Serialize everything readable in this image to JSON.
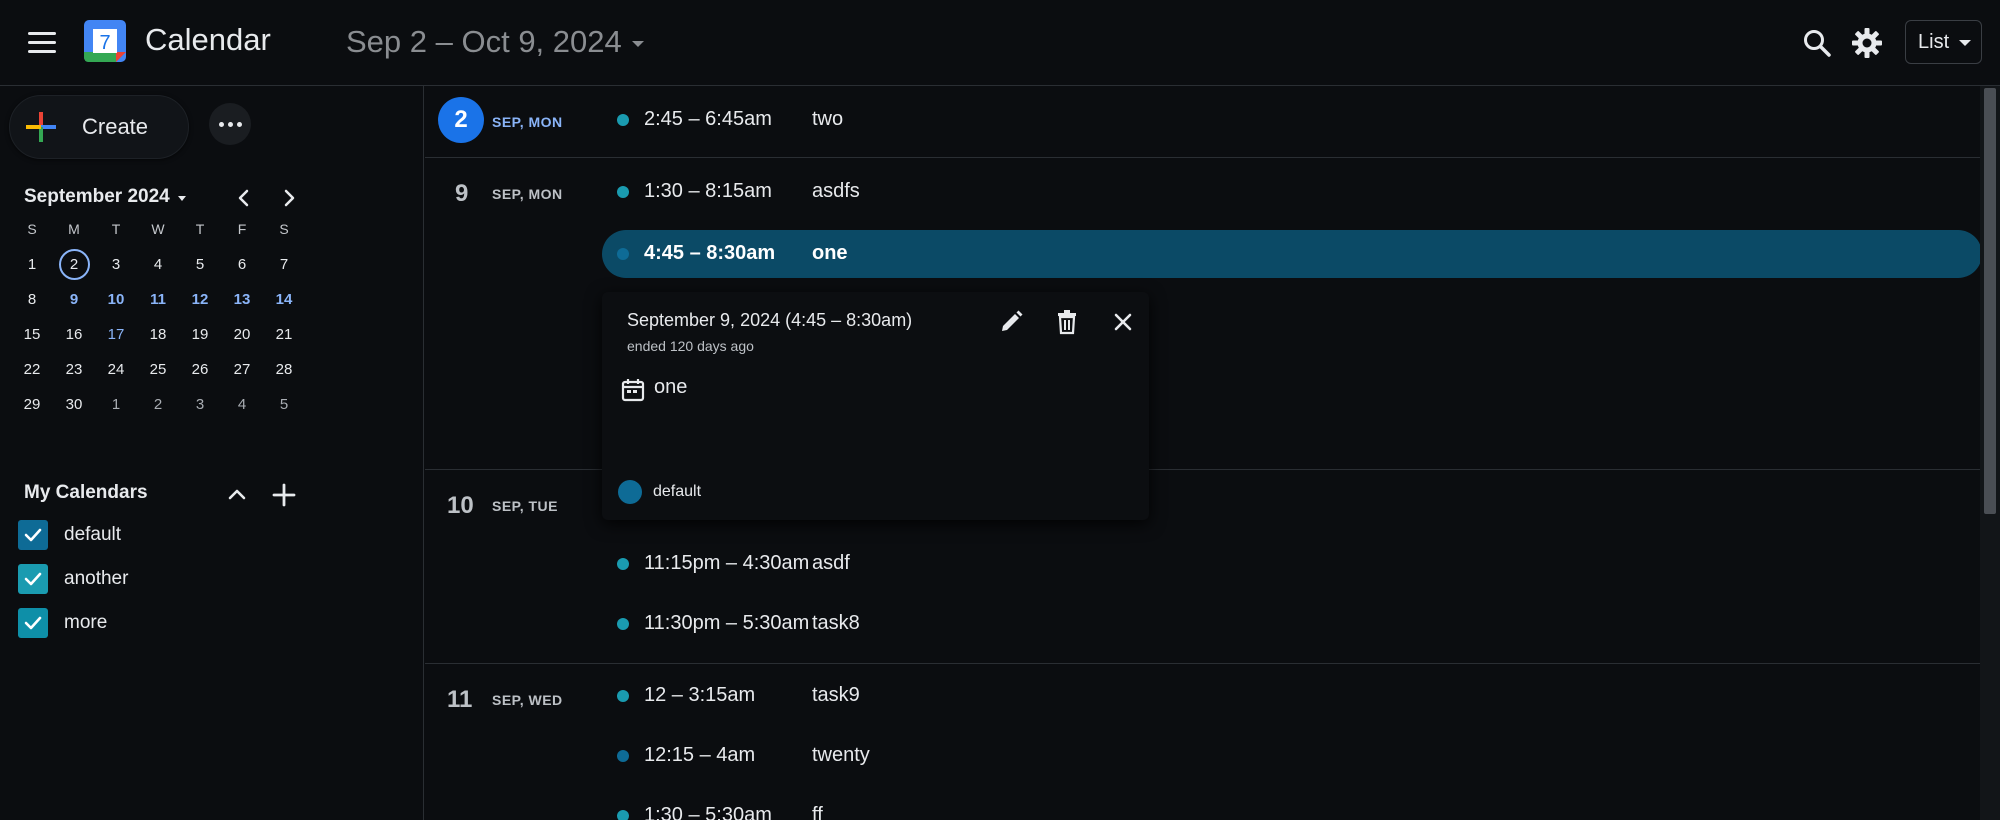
{
  "header": {
    "app_title": "Calendar",
    "logo_day": "7",
    "date_range": "Sep 2 – Oct 9, 2024",
    "view": "List"
  },
  "sidebar": {
    "create_label": "Create",
    "mini_calendar": {
      "month_label": "September 2024",
      "weekdays": [
        "S",
        "M",
        "T",
        "W",
        "T",
        "F",
        "S"
      ],
      "weeks": [
        [
          "1",
          "2",
          "3",
          "4",
          "5",
          "6",
          "7"
        ],
        [
          "8",
          "9",
          "10",
          "11",
          "12",
          "13",
          "14"
        ],
        [
          "15",
          "16",
          "17",
          "18",
          "19",
          "20",
          "21"
        ],
        [
          "22",
          "23",
          "24",
          "25",
          "26",
          "27",
          "28"
        ],
        [
          "29",
          "30",
          "1",
          "2",
          "3",
          "4",
          "5"
        ]
      ]
    },
    "my_calendars": {
      "title": "My Calendars",
      "items": [
        {
          "name": "default",
          "color": "#0e6b96"
        },
        {
          "name": "another",
          "color": "#1a9bb0"
        },
        {
          "name": "more",
          "color": "#0e8fa8"
        }
      ]
    }
  },
  "agenda": {
    "days": [
      {
        "num": "2",
        "label": "SEP, MON",
        "today": true,
        "events": [
          {
            "time": "2:45 – 6:45am",
            "title": "two",
            "color": "#1a9bb0"
          }
        ]
      },
      {
        "num": "9",
        "label": "SEP, MON",
        "today": false,
        "events": [
          {
            "time": "1:30 – 8:15am",
            "title": "asdfs",
            "color": "#1a9bb0"
          },
          {
            "time": "4:45 – 8:30am",
            "title": "one",
            "color": "#0e6b96",
            "active": true
          }
        ]
      },
      {
        "num": "10",
        "label": "SEP, TUE",
        "today": false,
        "events": [
          {
            "time": "11:15pm – 4:30am",
            "title": "asdf",
            "color": "#1a9bb0"
          },
          {
            "time": "11:30pm – 5:30am",
            "title": "task8",
            "color": "#1a9bb0"
          }
        ]
      },
      {
        "num": "11",
        "label": "SEP, WED",
        "today": false,
        "events": [
          {
            "time": "12 – 3:15am",
            "title": "task9",
            "color": "#1a9bb0"
          },
          {
            "time": "12:15 – 4am",
            "title": "twenty",
            "color": "#0e6b96"
          },
          {
            "time": "1:30 – 5:30am",
            "title": "ff",
            "color": "#1a9bb0"
          }
        ]
      }
    ]
  },
  "popover": {
    "date_line": "September 9, 2024 (4:45 – 8:30am)",
    "ended_line": "ended 120 days ago",
    "title": "one",
    "calendar_name": "default",
    "calendar_color": "#0e6b96"
  },
  "colors": {
    "accent": "#8ab4f8",
    "today_bg": "#1a73e8",
    "active_event_bg": "#0b4a66"
  }
}
